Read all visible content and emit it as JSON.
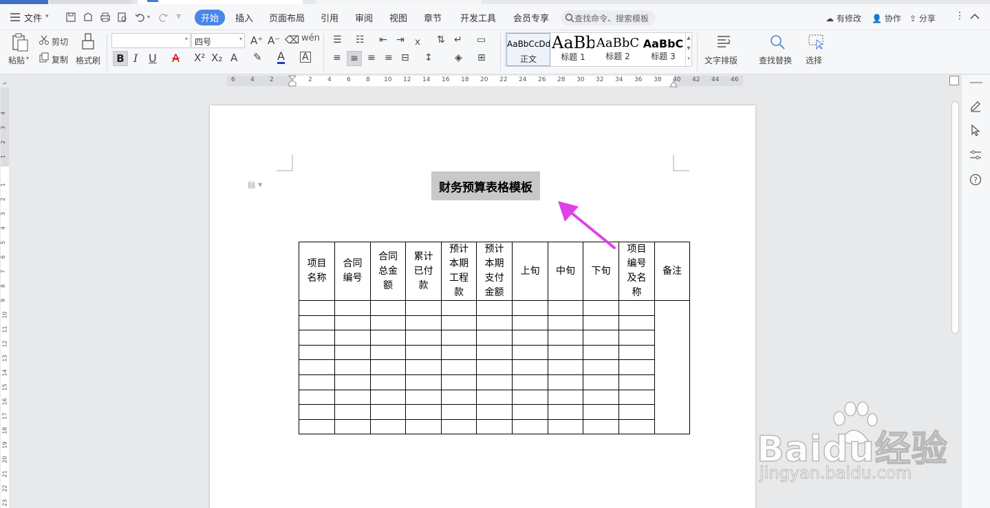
{
  "menu": {
    "file_label": "文件",
    "tabs": [
      "开始",
      "插入",
      "页面布局",
      "引用",
      "审阅",
      "视图",
      "章节",
      "开发工具",
      "会员专享"
    ],
    "search_placeholder": "查找命令、搜索模板",
    "right": {
      "modify": "有修改",
      "collab": "协作",
      "share": "分享"
    }
  },
  "ribbon": {
    "paste": "粘贴",
    "cut": "剪切",
    "copy": "复制",
    "format_painter": "格式刷",
    "font_name": "",
    "font_size": "四号",
    "styles": [
      {
        "preview": "AaBbCcDd",
        "label": "正文"
      },
      {
        "preview": "AaBb",
        "label": "标题 1"
      },
      {
        "preview": "AaBbC",
        "label": "标题 2"
      },
      {
        "preview": "AaBbC",
        "label": "标题 3"
      }
    ],
    "text_layout": "文字排版",
    "find_replace": "查找替换",
    "select": "选择"
  },
  "ruler": {
    "h_ticks": [
      "6",
      "4",
      "2",
      "2",
      "4",
      "6",
      "8",
      "10",
      "12",
      "14",
      "16",
      "18",
      "20",
      "22",
      "24",
      "26",
      "28",
      "30",
      "32",
      "34",
      "36",
      "38",
      "40",
      "42",
      "44",
      "46"
    ],
    "v_ticks": [
      "4",
      "3",
      "2",
      "1",
      "1",
      "2",
      "3",
      "4",
      "5",
      "6",
      "7",
      "8",
      "9",
      "10",
      "11",
      "12",
      "13",
      "14",
      "15",
      "16",
      "17",
      "18",
      "19",
      "20",
      "21",
      "22",
      "23"
    ]
  },
  "document": {
    "title": "财务预算表格模板",
    "table": {
      "headers": [
        "项目\n名称",
        "合同\n编号",
        "合同\n总金\n额",
        "累计\n已付\n款",
        "预计\n本期\n工程\n款",
        "预计\n本期\n支付\n金额",
        "上旬",
        "中旬",
        "下旬",
        "项目\n编号\n及名\n称",
        "备注"
      ],
      "empty_rows": 9
    }
  },
  "watermark": {
    "logo": "Baidu经验",
    "url": "jingyan.baidu.com"
  },
  "colors": {
    "accent": "#4a86e8",
    "arrow": "#e040e8",
    "title_highlight": "#c8c8c8"
  }
}
